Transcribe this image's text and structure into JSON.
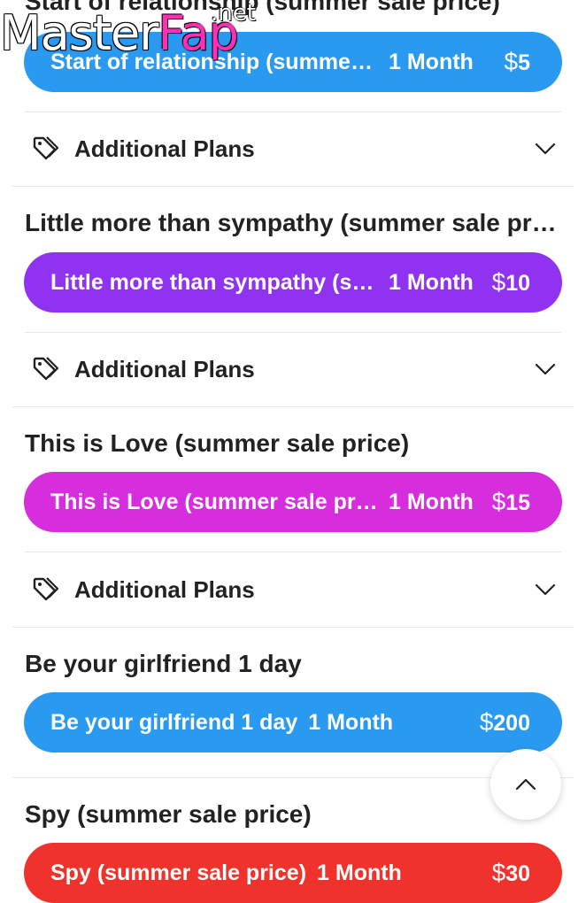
{
  "watermark": {
    "main": "Master",
    "accent": "Fap",
    "tld": ".net"
  },
  "colors": {
    "blue": "#2a9af1",
    "purple": "#8f33f0",
    "magenta": "#d62ddd",
    "red": "#f0322d"
  },
  "plans": [
    {
      "title": "Start of relationship (summer sale price)",
      "button_name": "Start of relationship (summer sale price)",
      "button_duration": "1 Month",
      "currency": "$",
      "button_price": "5",
      "color": "#2a9af1",
      "additional_label": "Additional Plans"
    },
    {
      "title": "Little more than sympathy (summer sale price)",
      "button_name": "Little more than sympathy (summer sale price)",
      "button_duration": "1 Month",
      "currency": "$",
      "button_price": "10",
      "color": "#8f33f0",
      "additional_label": "Additional Plans"
    },
    {
      "title": "This is Love (summer sale price)",
      "button_name": "This is Love (summer sale price)",
      "button_duration": "1 Month",
      "currency": "$",
      "button_price": "15",
      "color": "#d62ddd",
      "additional_label": "Additional Plans"
    },
    {
      "title": "Be your girlfriend 1 day",
      "button_name": "Be your girlfriend 1 day",
      "button_duration": "1 Month",
      "currency": "$",
      "button_price": "200",
      "color": "#2a9af1"
    },
    {
      "title": "Spy (summer sale price)",
      "button_name": "Spy (summer sale price)",
      "button_duration": "1 Month",
      "currency": "$",
      "button_price": "30",
      "color": "#f0322d"
    }
  ],
  "icons": {
    "tag": "tag-icon",
    "chevron": "chevron-down-icon",
    "scroll_top": "chevron-up-icon"
  }
}
